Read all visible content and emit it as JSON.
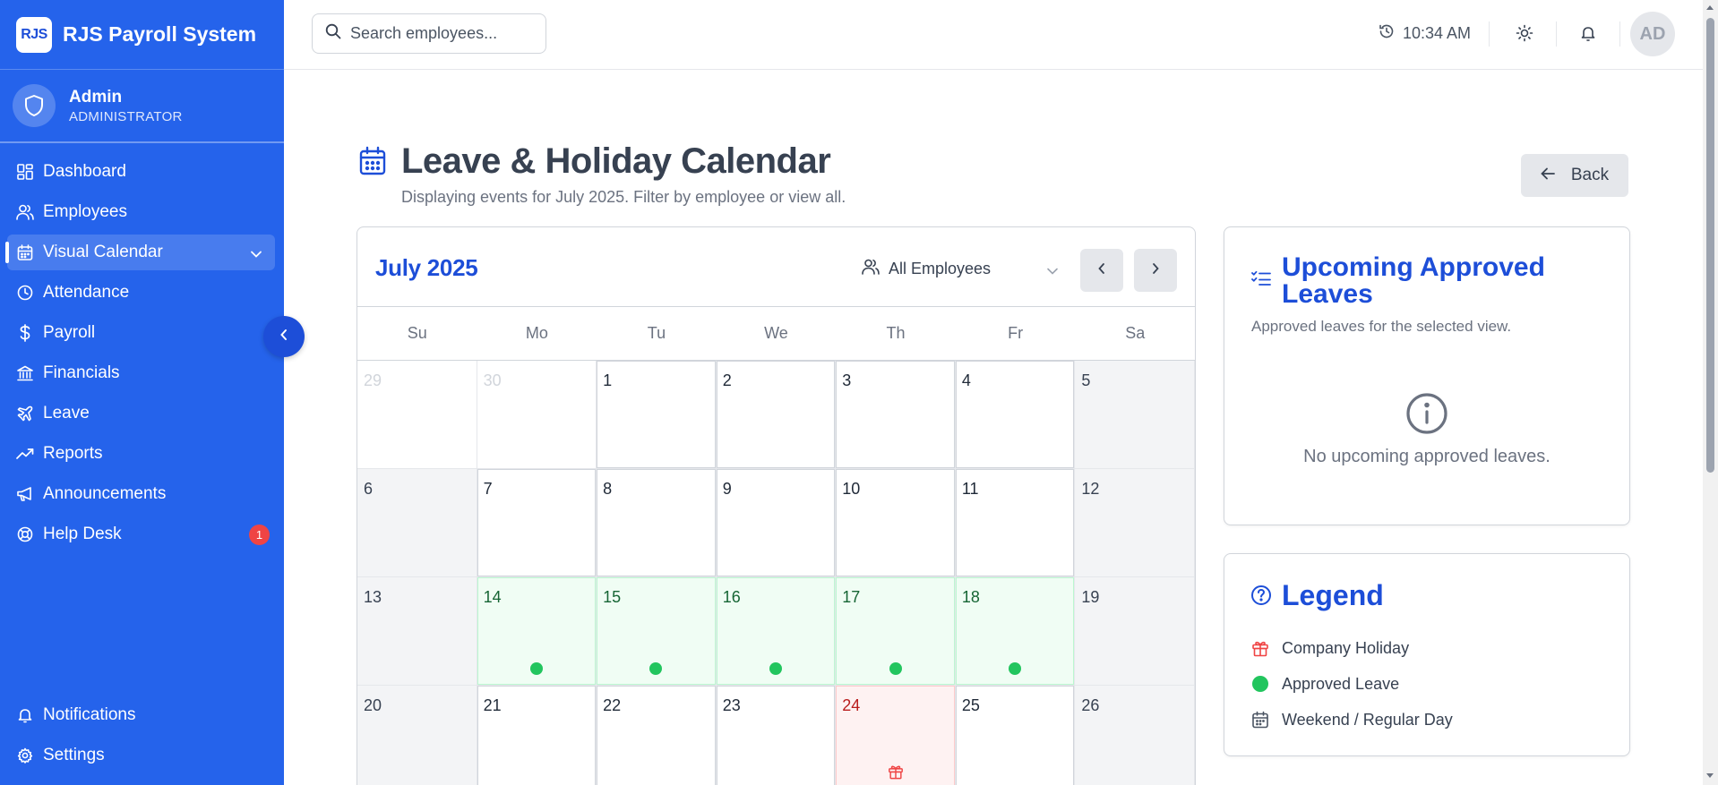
{
  "app": {
    "logo": "RJS",
    "title": "RJS Payroll System"
  },
  "user": {
    "name": "Admin",
    "role": "ADMINISTRATOR",
    "initials": "AD"
  },
  "sidebar": {
    "items": [
      {
        "label": "Dashboard",
        "icon": "dashboard-icon"
      },
      {
        "label": "Employees",
        "icon": "users-icon"
      },
      {
        "label": "Visual Calendar",
        "icon": "calendar-icon",
        "active": true
      },
      {
        "label": "Attendance",
        "icon": "clock-icon"
      },
      {
        "label": "Payroll",
        "icon": "dollar-icon"
      },
      {
        "label": "Financials",
        "icon": "bank-icon"
      },
      {
        "label": "Leave",
        "icon": "plane-icon"
      },
      {
        "label": "Reports",
        "icon": "trending-up-icon"
      },
      {
        "label": "Announcements",
        "icon": "megaphone-icon"
      },
      {
        "label": "Help Desk",
        "icon": "lifebuoy-icon",
        "badge": "1"
      }
    ],
    "bottom": [
      {
        "label": "Notifications",
        "icon": "bell-icon"
      },
      {
        "label": "Settings",
        "icon": "gear-icon"
      }
    ]
  },
  "topbar": {
    "search_placeholder": "Search employees...",
    "time": "10:34 AM"
  },
  "page": {
    "title": "Leave & Holiday Calendar",
    "subtitle": "Displaying events for July 2025. Filter by employee or view all.",
    "back_label": "Back"
  },
  "calendar": {
    "month_label": "July 2025",
    "employee_filter": "All Employees",
    "weekdays": [
      "Su",
      "Mo",
      "Tu",
      "We",
      "Th",
      "Fr",
      "Sa"
    ],
    "weeks": [
      [
        {
          "d": "29",
          "t": "outside"
        },
        {
          "d": "30",
          "t": "outside"
        },
        {
          "d": "1",
          "t": "weekday"
        },
        {
          "d": "2",
          "t": "weekday"
        },
        {
          "d": "3",
          "t": "weekday"
        },
        {
          "d": "4",
          "t": "weekday"
        },
        {
          "d": "5",
          "t": "weekend"
        }
      ],
      [
        {
          "d": "6",
          "t": "weekend"
        },
        {
          "d": "7",
          "t": "weekday"
        },
        {
          "d": "8",
          "t": "weekday"
        },
        {
          "d": "9",
          "t": "weekday"
        },
        {
          "d": "10",
          "t": "weekday"
        },
        {
          "d": "11",
          "t": "weekday"
        },
        {
          "d": "12",
          "t": "weekend"
        }
      ],
      [
        {
          "d": "13",
          "t": "weekend"
        },
        {
          "d": "14",
          "t": "leave"
        },
        {
          "d": "15",
          "t": "leave"
        },
        {
          "d": "16",
          "t": "leave"
        },
        {
          "d": "17",
          "t": "leave"
        },
        {
          "d": "18",
          "t": "leave"
        },
        {
          "d": "19",
          "t": "weekend"
        }
      ],
      [
        {
          "d": "20",
          "t": "weekend"
        },
        {
          "d": "21",
          "t": "weekday"
        },
        {
          "d": "22",
          "t": "weekday"
        },
        {
          "d": "23",
          "t": "weekday"
        },
        {
          "d": "24",
          "t": "holiday"
        },
        {
          "d": "25",
          "t": "weekday"
        },
        {
          "d": "26",
          "t": "weekend"
        }
      ]
    ]
  },
  "upcoming": {
    "title": "Upcoming Approved Leaves",
    "subtitle": "Approved leaves for the selected view.",
    "empty": "No upcoming approved leaves."
  },
  "legend": {
    "title": "Legend",
    "items": [
      {
        "label": "Company Holiday",
        "icon": "gift-icon"
      },
      {
        "label": "Approved Leave",
        "icon": "green-dot-icon"
      },
      {
        "label": "Weekend / Regular Day",
        "icon": "calendar-icon"
      }
    ]
  },
  "colors": {
    "primary": "#2563eb",
    "leave": "#22c55e",
    "holiday": "#ef4444"
  }
}
